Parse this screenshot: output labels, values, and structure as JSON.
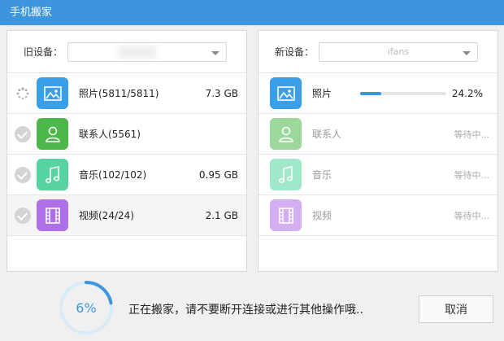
{
  "window": {
    "title": "手机搬家"
  },
  "old_device": {
    "label": "旧设备：",
    "selected": "",
    "items": [
      {
        "name": "照片(5811/5811)",
        "size": "7.3 GB",
        "status": "in-progress"
      },
      {
        "name": "联系人(5561)",
        "size": "",
        "status": "done"
      },
      {
        "name": "音乐(102/102)",
        "size": "0.95 GB",
        "status": "done"
      },
      {
        "name": "视频(24/24)",
        "size": "2.1 GB",
        "status": "done"
      }
    ]
  },
  "new_device": {
    "label": "新设备：",
    "selected": "ifans",
    "items": [
      {
        "name": "照片",
        "percent": "24.2%",
        "progress": 0.242
      },
      {
        "name": "联系人",
        "state": "等待中..."
      },
      {
        "name": "音乐",
        "state": "等待中..."
      },
      {
        "name": "视频",
        "state": "等待中..."
      }
    ]
  },
  "footer": {
    "overall_percent": "6%",
    "overall_progress": 0.06,
    "message": "正在搬家，请不要断开连接或进行其他操作哦..",
    "cancel_label": "取消"
  },
  "colors": {
    "accent": "#3d95dd",
    "photos": "#3a9fe8",
    "contacts": "#4cb84c",
    "music": "#55d4a0",
    "video": "#b06ee8"
  }
}
